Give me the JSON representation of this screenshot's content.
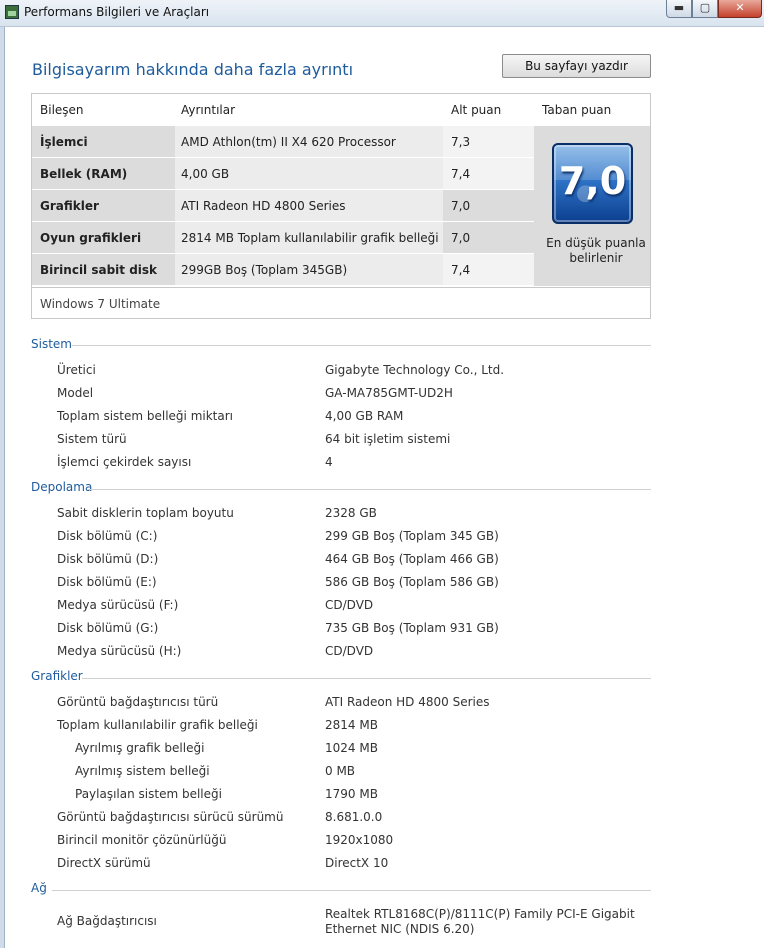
{
  "window": {
    "title": "Performans Bilgileri ve Araçları",
    "minimize": "▬",
    "maximize": "▢",
    "close": "✕"
  },
  "page": {
    "heading": "Bilgisayarım hakkında daha fazla ayrıntı",
    "print_button": "Bu sayfayı yazdır"
  },
  "scores": {
    "headers": {
      "component": "Bileşen",
      "details": "Ayrıntılar",
      "subscore": "Alt puan",
      "basescore": "Taban puan"
    },
    "rows": [
      {
        "component": "İşlemci",
        "details": "AMD Athlon(tm) II X4 620 Processor",
        "subscore": "7,3"
      },
      {
        "component": "Bellek (RAM)",
        "details": "4,00 GB",
        "subscore": "7,4"
      },
      {
        "component": "Grafikler",
        "details": "ATI Radeon HD 4800 Series",
        "subscore": "7,0"
      },
      {
        "component": "Oyun grafikleri",
        "details": "2814 MB Toplam kullanılabilir grafik belleği",
        "subscore": "7,0"
      },
      {
        "component": "Birincil sabit disk",
        "details": "299GB Boş (Toplam 345GB)",
        "subscore": "7,4"
      }
    ],
    "base_score": "7,0",
    "base_note": "En düşük puanla belirlenir",
    "os": "Windows 7 Ultimate"
  },
  "system": {
    "title": "Sistem",
    "items": [
      {
        "label": "Üretici",
        "value": "Gigabyte Technology Co., Ltd."
      },
      {
        "label": "Model",
        "value": "GA-MA785GMT-UD2H"
      },
      {
        "label": "Toplam sistem belleği miktarı",
        "value": "4,00 GB RAM"
      },
      {
        "label": "Sistem türü",
        "value": "64 bit işletim sistemi"
      },
      {
        "label": "İşlemci çekirdek sayısı",
        "value": "4"
      }
    ]
  },
  "storage": {
    "title": "Depolama",
    "items": [
      {
        "label": "Sabit disklerin toplam boyutu",
        "value": "2328 GB"
      },
      {
        "label": "Disk bölümü (C:)",
        "value": "299 GB Boş (Toplam 345 GB)"
      },
      {
        "label": "Disk bölümü (D:)",
        "value": "464 GB Boş (Toplam 466 GB)"
      },
      {
        "label": "Disk bölümü (E:)",
        "value": "586 GB Boş (Toplam 586 GB)"
      },
      {
        "label": "Medya sürücüsü (F:)",
        "value": "CD/DVD"
      },
      {
        "label": "Disk bölümü (G:)",
        "value": "735 GB Boş (Toplam 931 GB)"
      },
      {
        "label": "Medya sürücüsü (H:)",
        "value": "CD/DVD"
      }
    ]
  },
  "graphics": {
    "title": "Grafikler",
    "items": [
      {
        "label": "Görüntü bağdaştırıcısı türü",
        "value": "ATI Radeon HD 4800 Series"
      },
      {
        "label": "Toplam kullanılabilir grafik belleği",
        "value": "2814 MB"
      },
      {
        "label": "Ayrılmış grafik belleği",
        "value": "1024 MB"
      },
      {
        "label": "Ayrılmış sistem belleği",
        "value": "0 MB"
      },
      {
        "label": "Paylaşılan sistem belleği",
        "value": "1790 MB"
      },
      {
        "label": "Görüntü bağdaştırıcısı sürücü sürümü",
        "value": "8.681.0.0"
      },
      {
        "label": "Birincil monitör çözünürlüğü",
        "value": "1920x1080"
      },
      {
        "label": "DirectX sürümü",
        "value": "DirectX 10"
      }
    ]
  },
  "network": {
    "title": "Ağ",
    "items": [
      {
        "label": "Ağ Bağdaştırıcısı",
        "value": "Realtek RTL8168C(P)/8111C(P) Family PCI-E Gigabit Ethernet NIC (NDIS 6.20)"
      }
    ]
  },
  "colors": {
    "accent": "#1e5b9c",
    "badge": "#2f74c7"
  }
}
